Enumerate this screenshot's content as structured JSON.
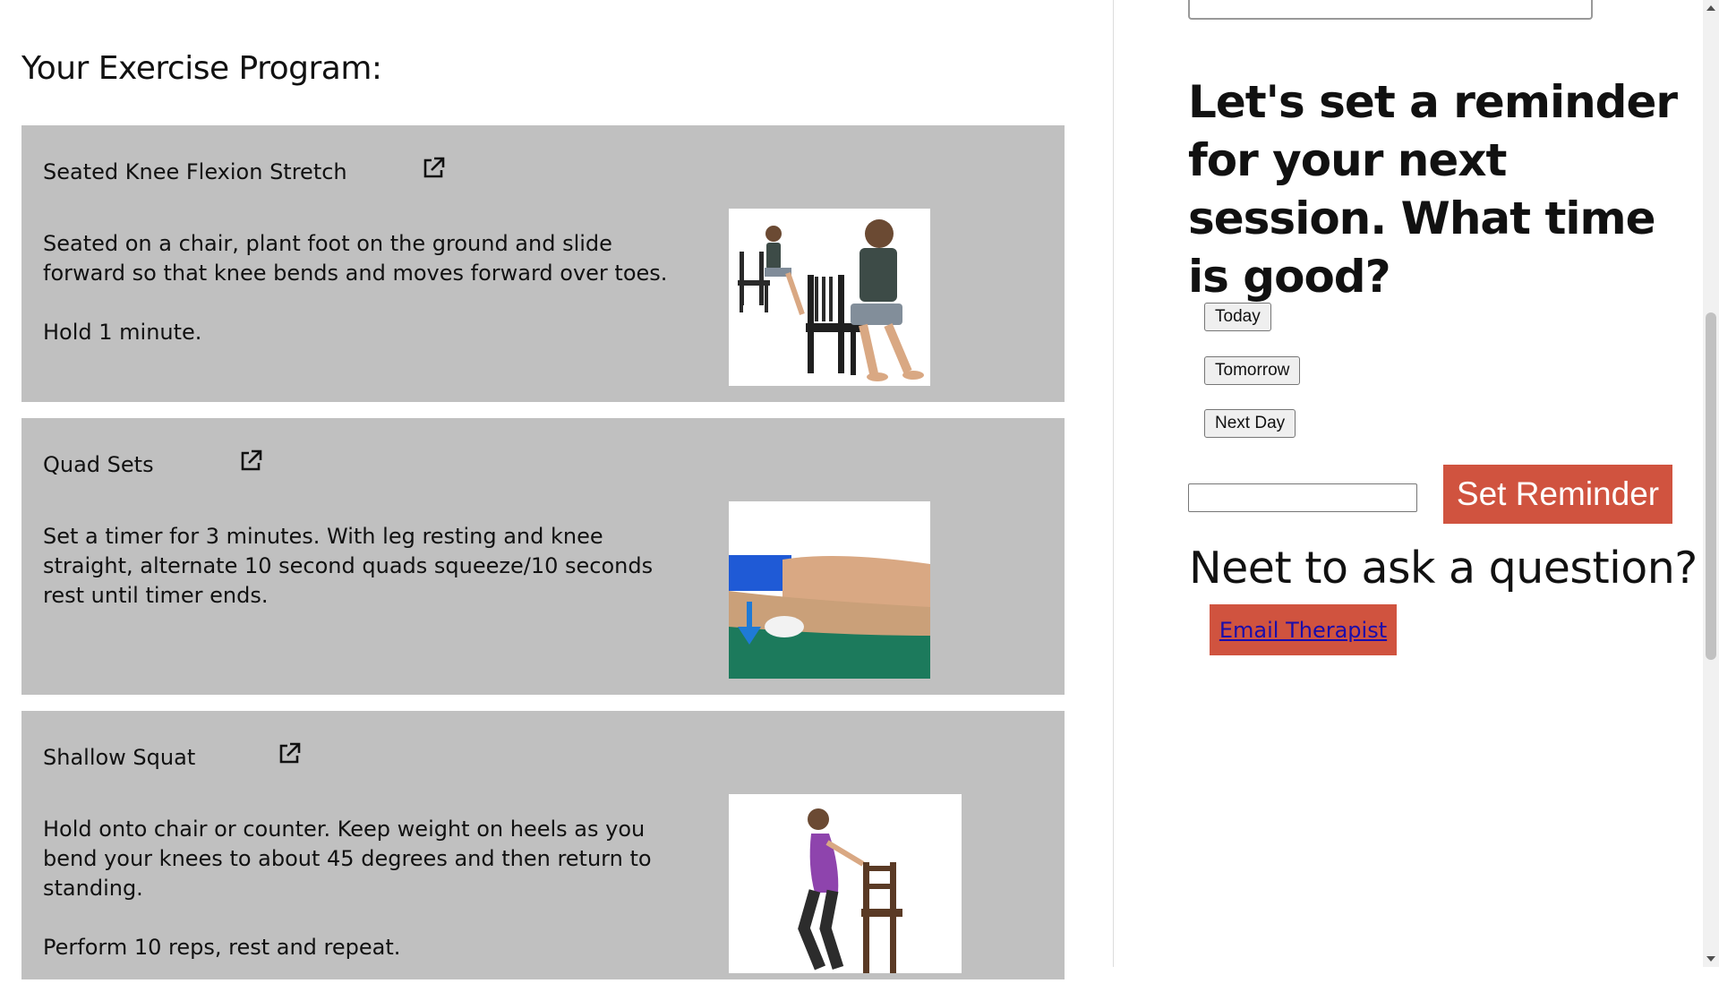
{
  "program": {
    "title": "Your Exercise Program:",
    "exercises": [
      {
        "name": "Seated Knee Flexion Stretch",
        "description": [
          "Seated on a chair, plant foot on the ground and slide forward so that knee bends and moves forward over toes.",
          "Hold 1 minute."
        ],
        "image": "seated-knee-flexion-illustration"
      },
      {
        "name": "Quad Sets",
        "description": [
          "Set a timer for 3 minutes. With leg resting and knee straight, alternate 10 second quads squeeze/10 seconds rest until timer ends."
        ],
        "image": "quad-sets-illustration"
      },
      {
        "name": "Shallow Squat",
        "description": [
          "Hold onto chair or counter. Keep weight on heels as you bend your knees to about 45 degrees and then return to standing.",
          "Perform 10 reps, rest and repeat."
        ],
        "image": "shallow-squat-illustration"
      }
    ]
  },
  "reminder": {
    "heading": "Let's set a reminder for your next session. What time is good?",
    "day_options": [
      "Today",
      "Tomorrow",
      "Next Day"
    ],
    "time_value": "",
    "set_label": "Set Reminder"
  },
  "question": {
    "heading": "Neet to ask a question?",
    "email_label": "Email Therapist"
  },
  "colors": {
    "card_bg": "#c0c0c0",
    "accent": "#d0533f",
    "link": "#1a0dab"
  },
  "icons": {
    "external_link": "external-link-icon"
  }
}
